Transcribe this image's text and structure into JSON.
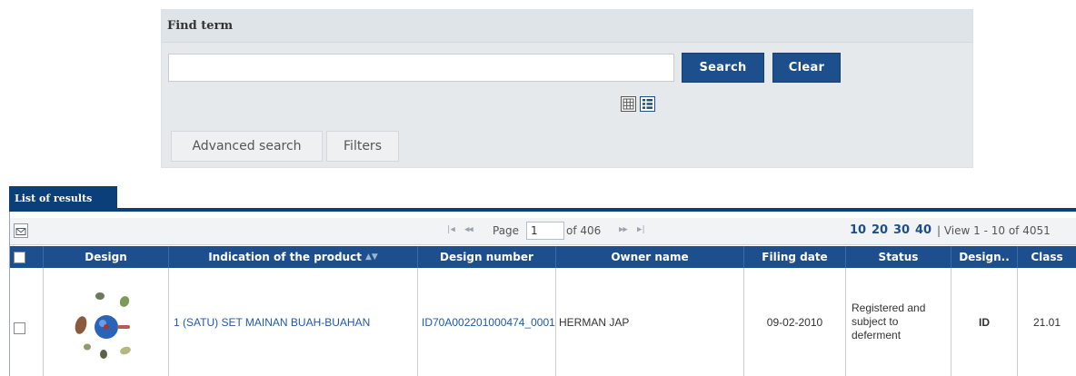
{
  "find_panel": {
    "title": "Find term",
    "search_value": "",
    "search_button": "Search",
    "clear_button": "Clear",
    "advanced_search_tab": "Advanced search",
    "filters_tab": "Filters"
  },
  "results": {
    "tab_label": "List of results",
    "pager": {
      "page_label": "Page",
      "page_value": "1",
      "of_label": "of 406",
      "rows_per_page": [
        "10",
        "20",
        "30",
        "40"
      ],
      "view_count": "| View 1 - 10 of 4051"
    },
    "columns": {
      "design": "Design",
      "indication": "Indication of the product",
      "design_number": "Design number",
      "owner": "Owner name",
      "filing_date": "Filing date",
      "status": "Status",
      "designation": "Design..",
      "class": "Class"
    },
    "rows": [
      {
        "indication": "1 (SATU) SET MAINAN BUAH-BUAHAN",
        "design_number": "ID70A002201000474_0001",
        "owner": "HERMAN JAP",
        "filing_date": "09-02-2010",
        "status": "Registered and subject to deferment",
        "designation": "ID",
        "class": "21.01"
      }
    ]
  },
  "colors": {
    "primary_button": "#1c4f8c",
    "table_header": "#1d4f8e",
    "link": "#1f5aa6",
    "panel_bg": "#e5e9ec"
  },
  "icons": [
    "grid-view-icon",
    "list-view-icon",
    "mail-icon",
    "first-page-icon",
    "prev-page-icon",
    "next-page-icon",
    "last-page-icon",
    "sort-icon"
  ]
}
